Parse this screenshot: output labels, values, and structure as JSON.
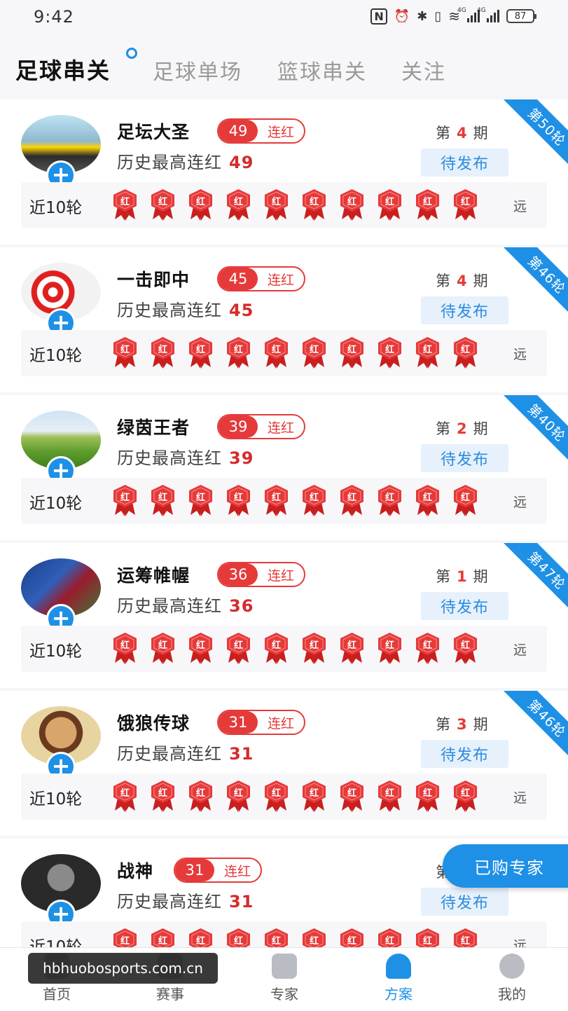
{
  "status_bar": {
    "time": "9:42",
    "battery": "87",
    "net_a": "4G",
    "net_b": "4G"
  },
  "tabs": [
    {
      "label": "足球串关",
      "active": true
    },
    {
      "label": "足球单场",
      "active": false
    },
    {
      "label": "篮球串关",
      "active": false
    },
    {
      "label": "关注",
      "active": false
    }
  ],
  "cards": [
    {
      "name": "足坛大圣",
      "streak": "49",
      "streak_label": "连红",
      "history_label": "历史最高连红",
      "history_value": "49",
      "period_prefix": "第",
      "period": "4",
      "period_suffix": "期",
      "status": "待发布",
      "ribbon": "第50轮",
      "recent_label": "近10轮",
      "medal_text": "红",
      "far_label": "远"
    },
    {
      "name": "一击即中",
      "streak": "45",
      "streak_label": "连红",
      "history_label": "历史最高连红",
      "history_value": "45",
      "period_prefix": "第",
      "period": "4",
      "period_suffix": "期",
      "status": "待发布",
      "ribbon": "第46轮",
      "recent_label": "近10轮",
      "medal_text": "红",
      "far_label": "远"
    },
    {
      "name": "绿茵王者",
      "streak": "39",
      "streak_label": "连红",
      "history_label": "历史最高连红",
      "history_value": "39",
      "period_prefix": "第",
      "period": "2",
      "period_suffix": "期",
      "status": "待发布",
      "ribbon": "第40轮",
      "recent_label": "近10轮",
      "medal_text": "红",
      "far_label": "远"
    },
    {
      "name": "运筹帷幄",
      "streak": "36",
      "streak_label": "连红",
      "history_label": "历史最高连红",
      "history_value": "36",
      "period_prefix": "第",
      "period": "1",
      "period_suffix": "期",
      "status": "待发布",
      "ribbon": "第47轮",
      "recent_label": "近10轮",
      "medal_text": "红",
      "far_label": "远"
    },
    {
      "name": "饿狼传球",
      "streak": "31",
      "streak_label": "连红",
      "history_label": "历史最高连红",
      "history_value": "31",
      "period_prefix": "第",
      "period": "3",
      "period_suffix": "期",
      "status": "待发布",
      "ribbon": "第46轮",
      "recent_label": "近10轮",
      "medal_text": "红",
      "far_label": "远"
    },
    {
      "name": "战神",
      "streak": "31",
      "streak_label": "连红",
      "history_label": "历史最高连红",
      "history_value": "31",
      "period_prefix": "第",
      "period": "",
      "period_suffix": "",
      "status": "待发布",
      "ribbon": "",
      "recent_label": "近10轮",
      "medal_text": "红",
      "far_label": "远"
    }
  ],
  "purchased_button": "已购专家",
  "bottom_nav": [
    {
      "label": "首页",
      "icon": "home-icon",
      "active": false
    },
    {
      "label": "赛事",
      "icon": "match-icon",
      "active": false
    },
    {
      "label": "专家",
      "icon": "expert-icon",
      "active": false
    },
    {
      "label": "方案",
      "icon": "plan-icon",
      "active": true
    },
    {
      "label": "我的",
      "icon": "profile-icon",
      "active": false
    }
  ],
  "watermark": "hbhuobosports.com.cn",
  "colors": {
    "accent": "#1e90e6",
    "red": "#e53a3a"
  }
}
